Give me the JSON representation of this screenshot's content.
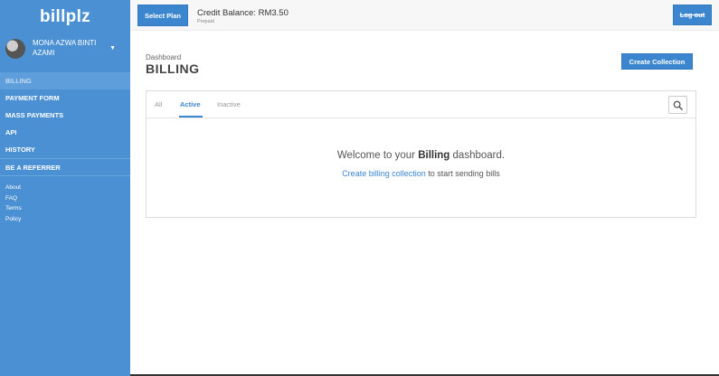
{
  "brand": {
    "logo": "billplz"
  },
  "user": {
    "name": "MONA AZWA BINTI AZAMI"
  },
  "sidebar": {
    "items": [
      {
        "label": "BILLING"
      },
      {
        "label": "PAYMENT FORM"
      },
      {
        "label": "MASS PAYMENTS"
      },
      {
        "label": "API"
      },
      {
        "label": "HISTORY"
      }
    ],
    "referrer": "BE A REFERRER",
    "links": [
      "About",
      "FAQ",
      "Terms",
      "Policy"
    ]
  },
  "topbar": {
    "select_plan": "Select Plan",
    "credit_title": "Credit Balance: RM3.50",
    "credit_sub": "Prepaid",
    "logout": "Log out"
  },
  "main": {
    "breadcrumb": "Dashboard",
    "title": "BILLING",
    "create_button": "Create Collection",
    "tabs": [
      {
        "label": "All"
      },
      {
        "label": "Active"
      },
      {
        "label": "Inactive"
      }
    ],
    "welcome_prefix": "Welcome to your",
    "welcome_bold": "Billing",
    "welcome_suffix": "dashboard.",
    "hint_link": "Create billing collection",
    "hint_text": "to start sending bills"
  },
  "colors": {
    "sidebar": "#4a90d2",
    "accent": "#3b86ce"
  },
  "icons": {
    "search": "search-icon",
    "caret": "caret-down-icon",
    "avatar": "avatar"
  }
}
